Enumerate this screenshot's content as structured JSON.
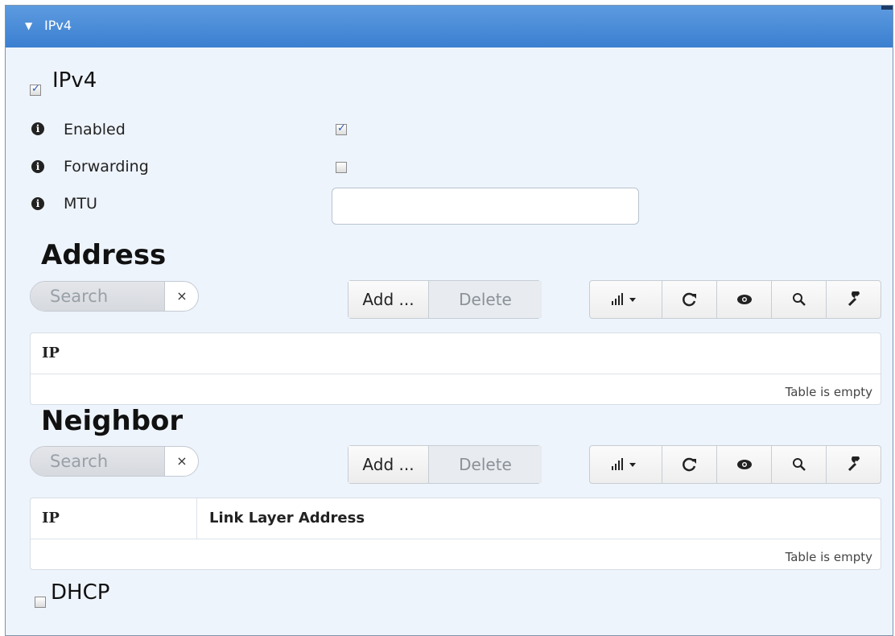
{
  "panel": {
    "title": "IPv4"
  },
  "ipv4": {
    "label": "IPv4",
    "checked": true,
    "fields": [
      {
        "label": "Enabled",
        "checked": true
      },
      {
        "label": "Forwarding",
        "checked": false
      },
      {
        "label": "MTU",
        "value": ""
      }
    ]
  },
  "address": {
    "title": "Address",
    "search_placeholder": "Search",
    "clear_symbol": "×",
    "add_label": "Add ...",
    "delete_label": "Delete",
    "columns": [
      "IP"
    ],
    "empty_text": "Table is empty"
  },
  "neighbor": {
    "title": "Neighbor",
    "search_placeholder": "Search",
    "clear_symbol": "×",
    "add_label": "Add ...",
    "delete_label": "Delete",
    "columns": [
      "IP",
      "Link Layer Address"
    ],
    "empty_text": "Table is empty"
  },
  "dhcp": {
    "label": "DHCP",
    "checked": false
  },
  "icons": [
    "caret-down-icon",
    "info-icon",
    "signal-bars-icon",
    "refresh-icon",
    "eye-icon",
    "search-icon",
    "wrench-icon",
    "close-icon"
  ]
}
